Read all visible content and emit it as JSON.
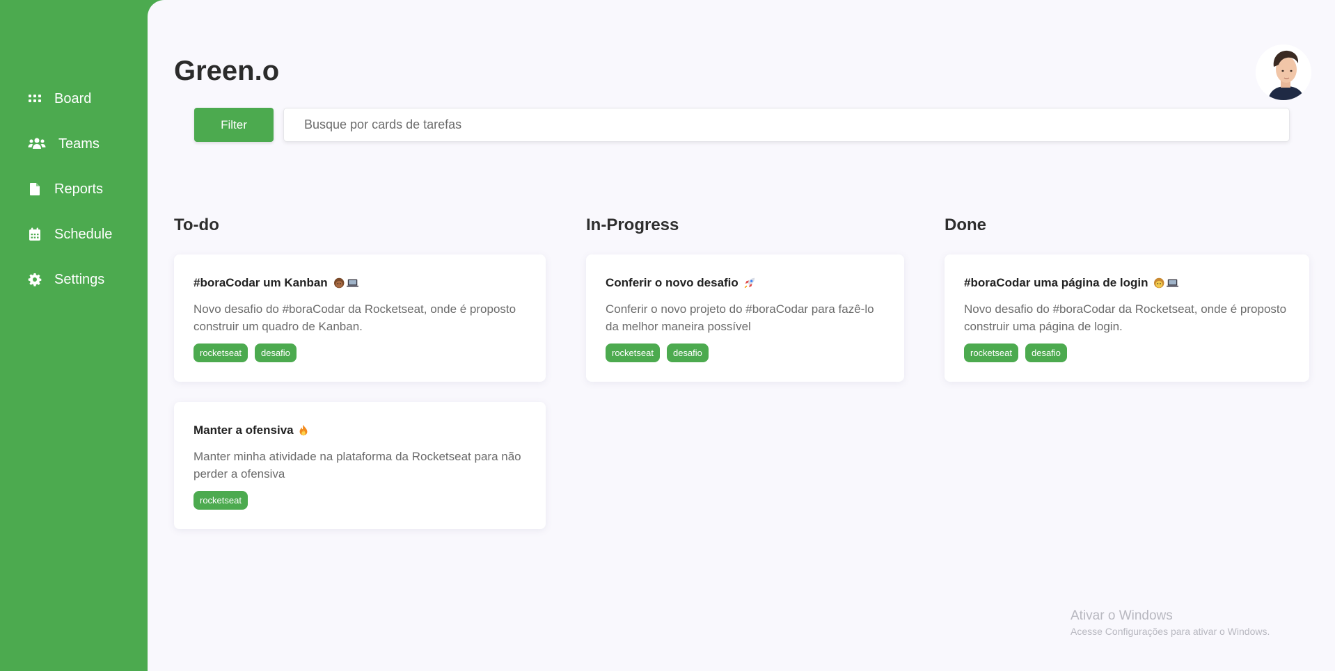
{
  "sidebar": {
    "items": [
      {
        "label": "Board",
        "icon": "grid-icon"
      },
      {
        "label": "Teams",
        "icon": "users-icon"
      },
      {
        "label": "Reports",
        "icon": "file-icon"
      },
      {
        "label": "Schedule",
        "icon": "calendar-icon"
      },
      {
        "label": "Settings",
        "icon": "gear-icon"
      }
    ]
  },
  "header": {
    "brand": "Green.o",
    "filter_label": "Filter",
    "search_placeholder": "Busque por cards de tarefas"
  },
  "columns": [
    {
      "title": "To-do",
      "cards": [
        {
          "title": "#boraCodar um Kanban",
          "emoji": "developer-laptop-icon",
          "description": "Novo desafio do #boraCodar da Rocketseat, onde é proposto construir um quadro de Kanban.",
          "tags": [
            "rocketseat",
            "desafio"
          ]
        },
        {
          "title": "Manter a ofensiva",
          "emoji": "fire-icon",
          "description": "Manter minha atividade na plataforma da Rocketseat para não perder a ofensiva",
          "tags": [
            "rocketseat"
          ]
        }
      ]
    },
    {
      "title": "In-Progress",
      "cards": [
        {
          "title": "Conferir o novo desafio",
          "emoji": "rocket-icon",
          "description": "Conferir o novo projeto do #boraCodar para fazê-lo da melhor maneira possível",
          "tags": [
            "rocketseat",
            "desafio"
          ]
        }
      ]
    },
    {
      "title": "Done",
      "cards": [
        {
          "title": "#boraCodar uma página de login",
          "emoji": "developer-laptop-icon",
          "description": "Novo desafio do #boraCodar da Rocketseat, onde é proposto construir uma página de login.",
          "tags": [
            "rocketseat",
            "desafio"
          ]
        }
      ]
    }
  ],
  "watermark": {
    "line1": "Ativar o Windows",
    "line2": "Acesse Configurações para ativar o Windows."
  },
  "colors": {
    "accent": "#4caa4f",
    "background": "#f9f8fd"
  }
}
